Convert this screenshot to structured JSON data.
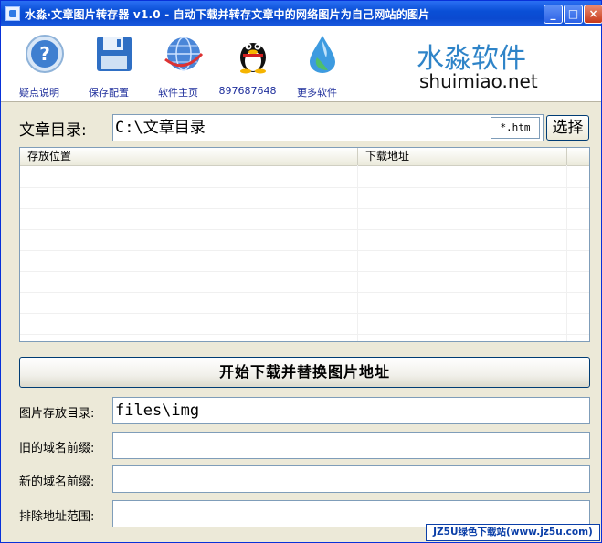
{
  "window": {
    "title": "水淼·文章图片转存器 v1.0 - 自动下载并转存文章中的网络图片为自己网站的图片",
    "controls": {
      "minimize": "_",
      "maximize": "□",
      "close": "×"
    }
  },
  "toolbar": {
    "items": [
      {
        "label": "疑点说明",
        "icon": "help-icon"
      },
      {
        "label": "保存配置",
        "icon": "floppy-disk-icon"
      },
      {
        "label": "软件主页",
        "icon": "globe-icon"
      },
      {
        "label": "897687648",
        "icon": "qq-penguin-icon"
      },
      {
        "label": "更多软件",
        "icon": "water-drop-icon"
      }
    ],
    "brand_cn": "水淼软件",
    "brand_en": "shuimiao.net"
  },
  "article_dir": {
    "label": "文章目录:",
    "value": "C:\\文章目录",
    "ext_filter": "*.htm",
    "select_button": "选择"
  },
  "list": {
    "columns": [
      "存放位置",
      "下载地址"
    ],
    "rows": []
  },
  "start_button": "开始下载并替换图片地址",
  "fields": [
    {
      "label": "图片存放目录:",
      "value": "files\\img"
    },
    {
      "label": "旧的域名前缀:",
      "value": ""
    },
    {
      "label": "新的域名前缀:",
      "value": ""
    },
    {
      "label": "排除地址范围:",
      "value": ""
    }
  ],
  "watermark": "JZ5U绿色下载站(www.jz5u.com)",
  "colors": {
    "titlebar": "#0a4fd6",
    "brand": "#2f84c8",
    "toolbar_label": "#1f2f9c"
  }
}
